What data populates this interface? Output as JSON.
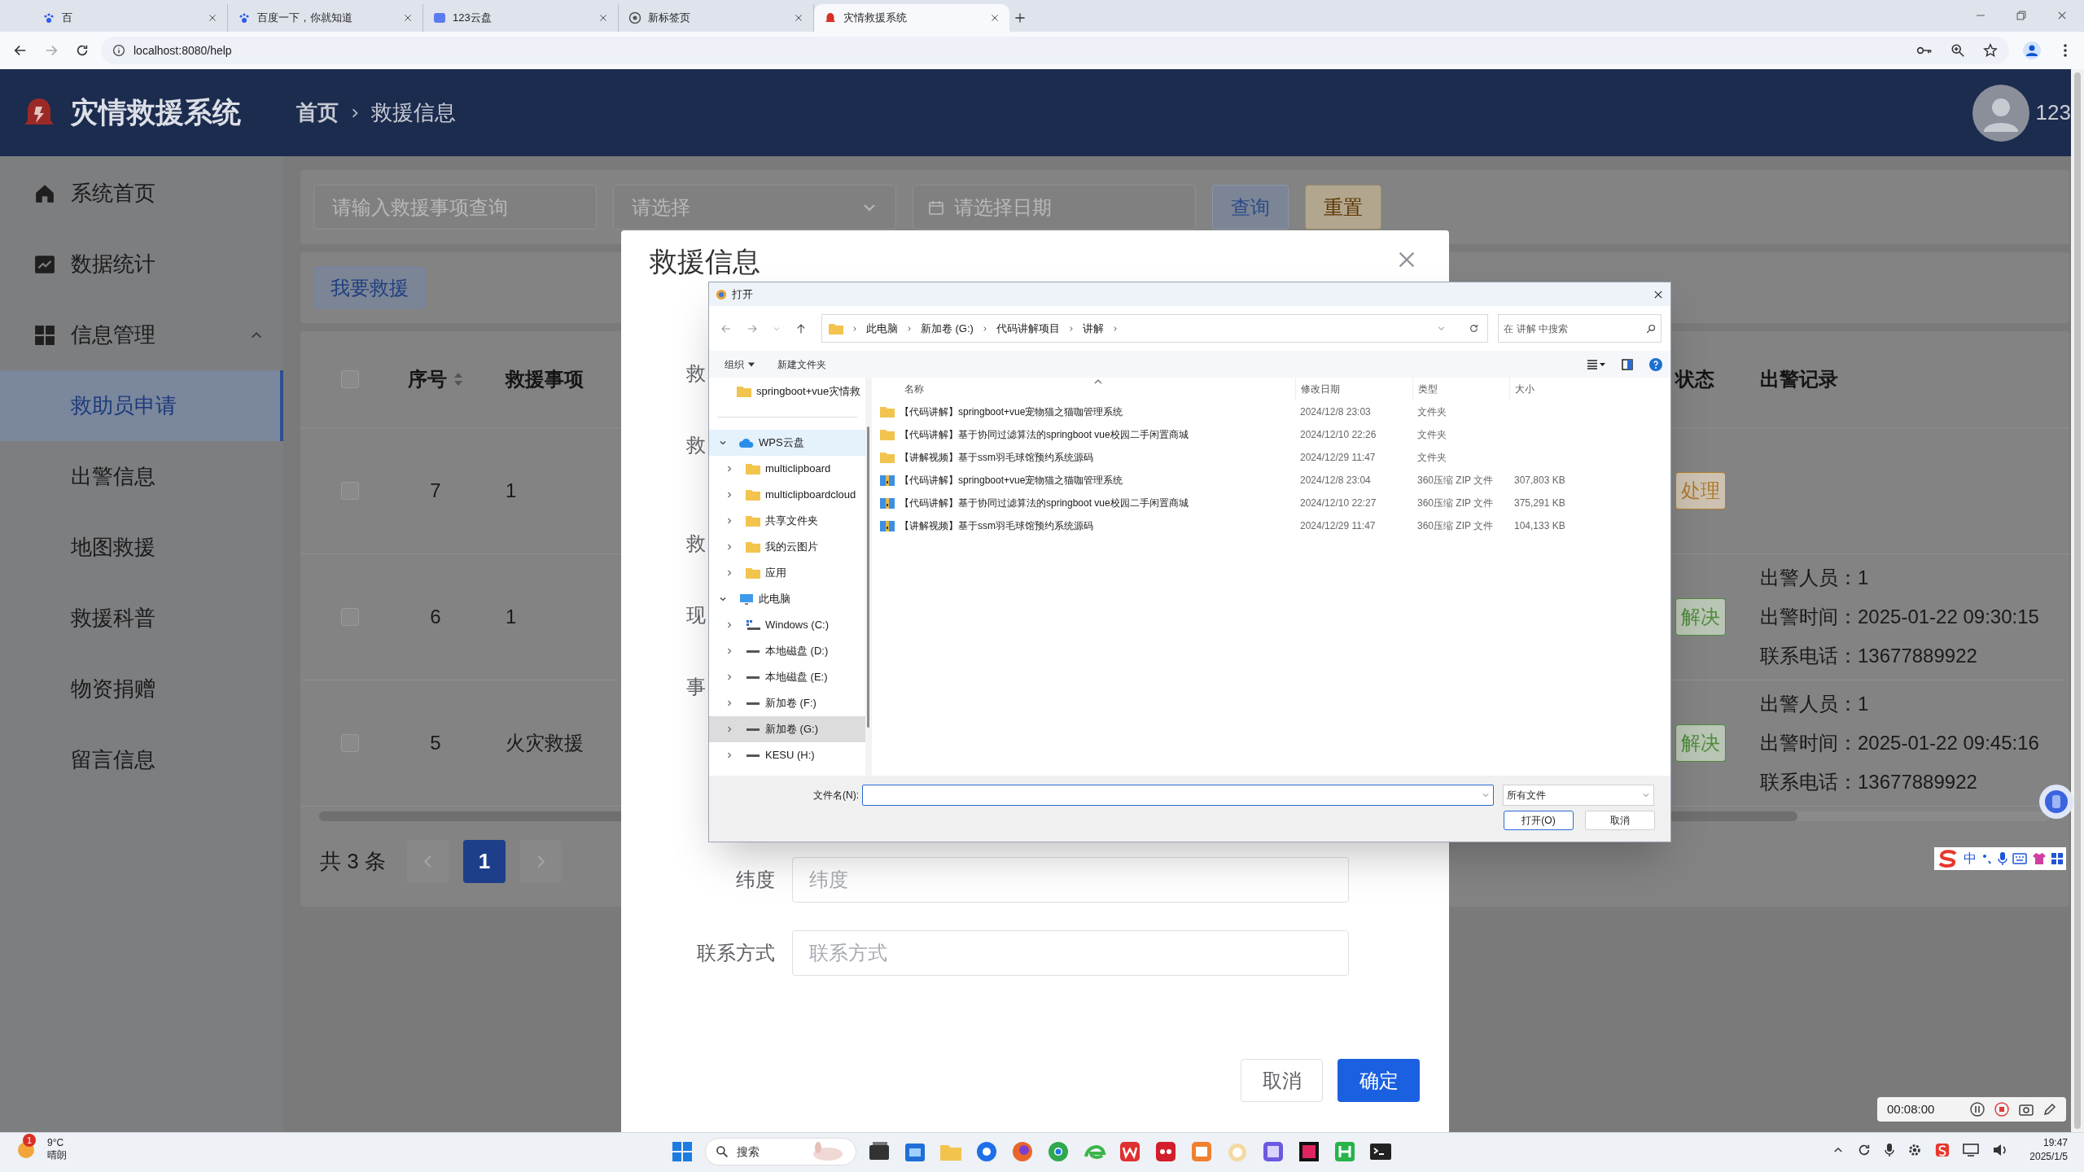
{
  "browser": {
    "tabs": [
      {
        "label": "百",
        "selected": false
      },
      {
        "label": "百度一下，你就知道",
        "selected": false
      },
      {
        "label": "123云盘",
        "selected": false
      },
      {
        "label": "新标签页",
        "selected": false
      },
      {
        "label": "灾情救援系统",
        "selected": true
      }
    ],
    "url": "localhost:8080/help"
  },
  "header": {
    "title": "灾情救援系统",
    "breadcrumb": [
      "首页",
      "救援信息"
    ],
    "user": "123"
  },
  "sidebar": [
    {
      "label": "系统首页",
      "selected": false
    },
    {
      "label": "数据统计",
      "selected": false
    },
    {
      "label": "信息管理",
      "selected": false,
      "expanded": true,
      "children": [
        {
          "label": "救助员申请",
          "selected": true
        },
        {
          "label": "出警信息",
          "selected": false
        },
        {
          "label": "地图救援",
          "selected": false
        },
        {
          "label": "救援科普",
          "selected": false
        },
        {
          "label": "物资捐赠",
          "selected": false
        },
        {
          "label": "留言信息",
          "selected": false
        }
      ]
    }
  ],
  "search": {
    "query_placeholder": "请输入救援事项查询",
    "select_placeholder": "请选择",
    "date_placeholder": "请选择日期",
    "buttons": [
      {
        "label": "查询",
        "kind": "primary"
      },
      {
        "label": "重置",
        "kind": "warning"
      }
    ]
  },
  "add_button": "我要救援",
  "table": {
    "select_all": {
      "checked": false
    },
    "columns": [
      {
        "label": "序号",
        "sortable": true
      },
      {
        "label": "救援事项",
        "sortable": false
      },
      {
        "label": "状态",
        "sortable": false
      },
      {
        "label": "出警记录",
        "sortable": false
      }
    ],
    "rows": [
      {
        "checked": false,
        "no": "7",
        "item": "1",
        "status": "处理",
        "color": "#b07a2a"
      },
      {
        "checked": false,
        "no": "6",
        "item": "1",
        "status": "解决",
        "color": "#4f8a3a",
        "records": [
          "出警人员：1",
          "出警时间：2025-01-22 09:30:15",
          "联系电话：13677889922"
        ]
      },
      {
        "checked": false,
        "no": "5",
        "item": "火灾救援",
        "status": "解决",
        "color": "#4f8a3a",
        "records": [
          "出警人员：1",
          "出警时间：2025-01-22 09:45:16",
          "联系电话：13677889922"
        ]
      }
    ]
  },
  "pagination": {
    "total": "共 3 条",
    "pages": [
      {
        "label": "1",
        "selected": true
      }
    ]
  },
  "modal": {
    "title": "救援信息",
    "fields": [
      {
        "kind": "covered",
        "label": "救"
      },
      {
        "kind": "covered",
        "label": "救"
      },
      {
        "kind": "covered",
        "label": "救"
      },
      {
        "kind": "covered",
        "label": "现"
      },
      {
        "kind": "covered",
        "label": "事"
      },
      {
        "kind": "input",
        "label": "纬度",
        "placeholder": "纬度"
      },
      {
        "kind": "input",
        "label": "联系方式",
        "placeholder": "联系方式"
      }
    ],
    "buttons": [
      {
        "label": "取消",
        "kind": "default"
      },
      {
        "label": "确定",
        "kind": "primary"
      }
    ]
  },
  "file_dialog": {
    "title": "打开",
    "path": [
      "此电脑",
      "新加卷 (G:)",
      "代码讲解项目",
      "讲解"
    ],
    "search_placeholder": "在 讲解 中搜索",
    "toolbar": [
      "组织",
      "新建文件夹"
    ],
    "tree": [
      {
        "kind": "folder",
        "label": "springboot+vue灾情救",
        "selected": false,
        "hovered": false
      },
      {
        "kind": "cloud",
        "label": "WPS云盘",
        "selected": false,
        "hovered": true,
        "expanded": true,
        "children": [
          {
            "kind": "folder",
            "label": "multiclipboard",
            "selected": false,
            "hovered": false,
            "expanded": false
          },
          {
            "kind": "folder",
            "label": "multiclipboardcloud",
            "selected": false,
            "hovered": false,
            "expanded": false
          },
          {
            "kind": "folder",
            "label": "共享文件夹",
            "selected": false,
            "hovered": false,
            "expanded": false
          },
          {
            "kind": "folder",
            "label": "我的云图片",
            "selected": false,
            "hovered": false,
            "expanded": false
          },
          {
            "kind": "folder",
            "label": "应用",
            "selected": false,
            "hovered": false,
            "expanded": false
          }
        ]
      },
      {
        "kind": "pc",
        "label": "此电脑",
        "selected": false,
        "hovered": false,
        "expanded": true,
        "children": [
          {
            "kind": "system-drive",
            "label": "Windows (C:)",
            "selected": false,
            "hovered": false,
            "expanded": false
          },
          {
            "kind": "drive",
            "label": "本地磁盘 (D:)",
            "selected": false,
            "hovered": false,
            "expanded": false
          },
          {
            "kind": "drive",
            "label": "本地磁盘 (E:)",
            "selected": false,
            "hovered": false,
            "expanded": false
          },
          {
            "kind": "drive",
            "label": "新加卷 (F:)",
            "selected": false,
            "hovered": false,
            "expanded": false
          },
          {
            "kind": "drive",
            "label": "新加卷 (G:)",
            "selected": true,
            "hovered": false,
            "expanded": false
          },
          {
            "kind": "drive",
            "label": "KESU  (H:)",
            "selected": false,
            "hovered": false,
            "expanded": false
          }
        ]
      }
    ],
    "columns": [
      "名称",
      "修改日期",
      "类型",
      "大小"
    ],
    "files": [
      {
        "kind": "folder",
        "name": "【代码讲解】springboot+vue宠物猫之猫咖管理系统",
        "date": "2024/12/8 23:03",
        "type": "文件夹"
      },
      {
        "kind": "folder",
        "name": "【代码讲解】基于协同过滤算法的springboot vue校园二手闲置商城",
        "date": "2024/12/10 22:26",
        "type": "文件夹"
      },
      {
        "kind": "folder",
        "name": "【讲解视频】基于ssm羽毛球馆预约系统源码",
        "date": "2024/12/29 11:47",
        "type": "文件夹"
      },
      {
        "kind": "zip",
        "name": "【代码讲解】springboot+vue宠物猫之猫咖管理系统",
        "date": "2024/12/8 23:04",
        "type": "360压缩 ZIP 文件",
        "size": "307,803 KB"
      },
      {
        "kind": "zip",
        "name": "【代码讲解】基于协同过滤算法的springboot vue校园二手闲置商城",
        "date": "2024/12/10 22:27",
        "type": "360压缩 ZIP 文件",
        "size": "375,291 KB"
      },
      {
        "kind": "zip",
        "name": "【讲解视频】基于ssm羽毛球馆预约系统源码",
        "date": "2024/12/29 11:47",
        "type": "360压缩 ZIP 文件",
        "size": "104,133 KB"
      }
    ],
    "filename_label": "文件名(N):",
    "filter": "所有文件",
    "buttons": [
      {
        "label": "打开(O)",
        "kind": "primary"
      },
      {
        "label": "取消",
        "kind": "default"
      }
    ]
  },
  "ime": {
    "mode": "中"
  },
  "recorder": {
    "time": "00:08:00"
  },
  "taskbar": {
    "weather": {
      "badge": "1",
      "temp": "9°C",
      "text": "晴朗"
    },
    "search": "搜索",
    "clock": {
      "time": "19:47",
      "date": "2025/1/5"
    }
  }
}
